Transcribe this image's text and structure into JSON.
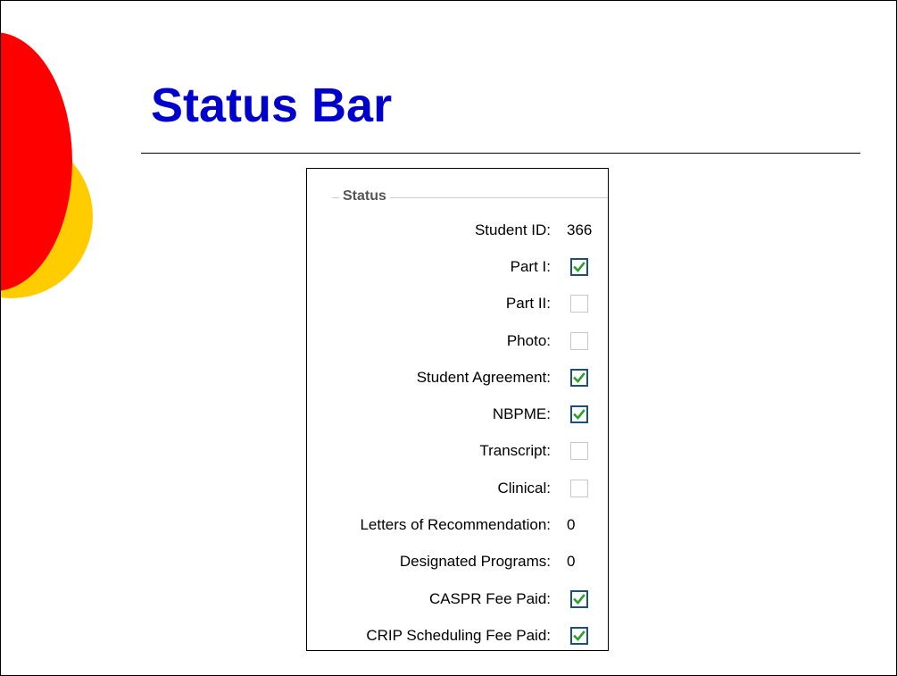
{
  "slide": {
    "title": "Status Bar"
  },
  "status_panel": {
    "legend": "Status",
    "rows": [
      {
        "label": "Student ID:",
        "type": "value",
        "value": "366"
      },
      {
        "label": "Part I:",
        "type": "checkbox",
        "checked": true
      },
      {
        "label": "Part II:",
        "type": "checkbox",
        "checked": false
      },
      {
        "label": "Photo:",
        "type": "checkbox",
        "checked": false
      },
      {
        "label": "Student Agreement:",
        "type": "checkbox",
        "checked": true
      },
      {
        "label": "NBPME:",
        "type": "checkbox",
        "checked": true
      },
      {
        "label": "Transcript:",
        "type": "checkbox",
        "checked": false
      },
      {
        "label": "Clinical:",
        "type": "checkbox",
        "checked": false
      },
      {
        "label": "Letters of Recommendation:",
        "type": "value",
        "value": "0"
      },
      {
        "label": "Designated Programs:",
        "type": "value",
        "value": "0"
      },
      {
        "label": "CASPR Fee Paid:",
        "type": "checkbox",
        "checked": true
      },
      {
        "label": "CRIP Scheduling Fee Paid:",
        "type": "checkbox",
        "checked": true
      }
    ]
  },
  "colors": {
    "title": "#0000cc",
    "circle_red": "#ff0000",
    "circle_yellow": "#ffcc00",
    "check_mark": "#2ca02c",
    "checkbox_border": "#1f4e79"
  },
  "icons": {
    "checked": "check-mark-icon"
  }
}
